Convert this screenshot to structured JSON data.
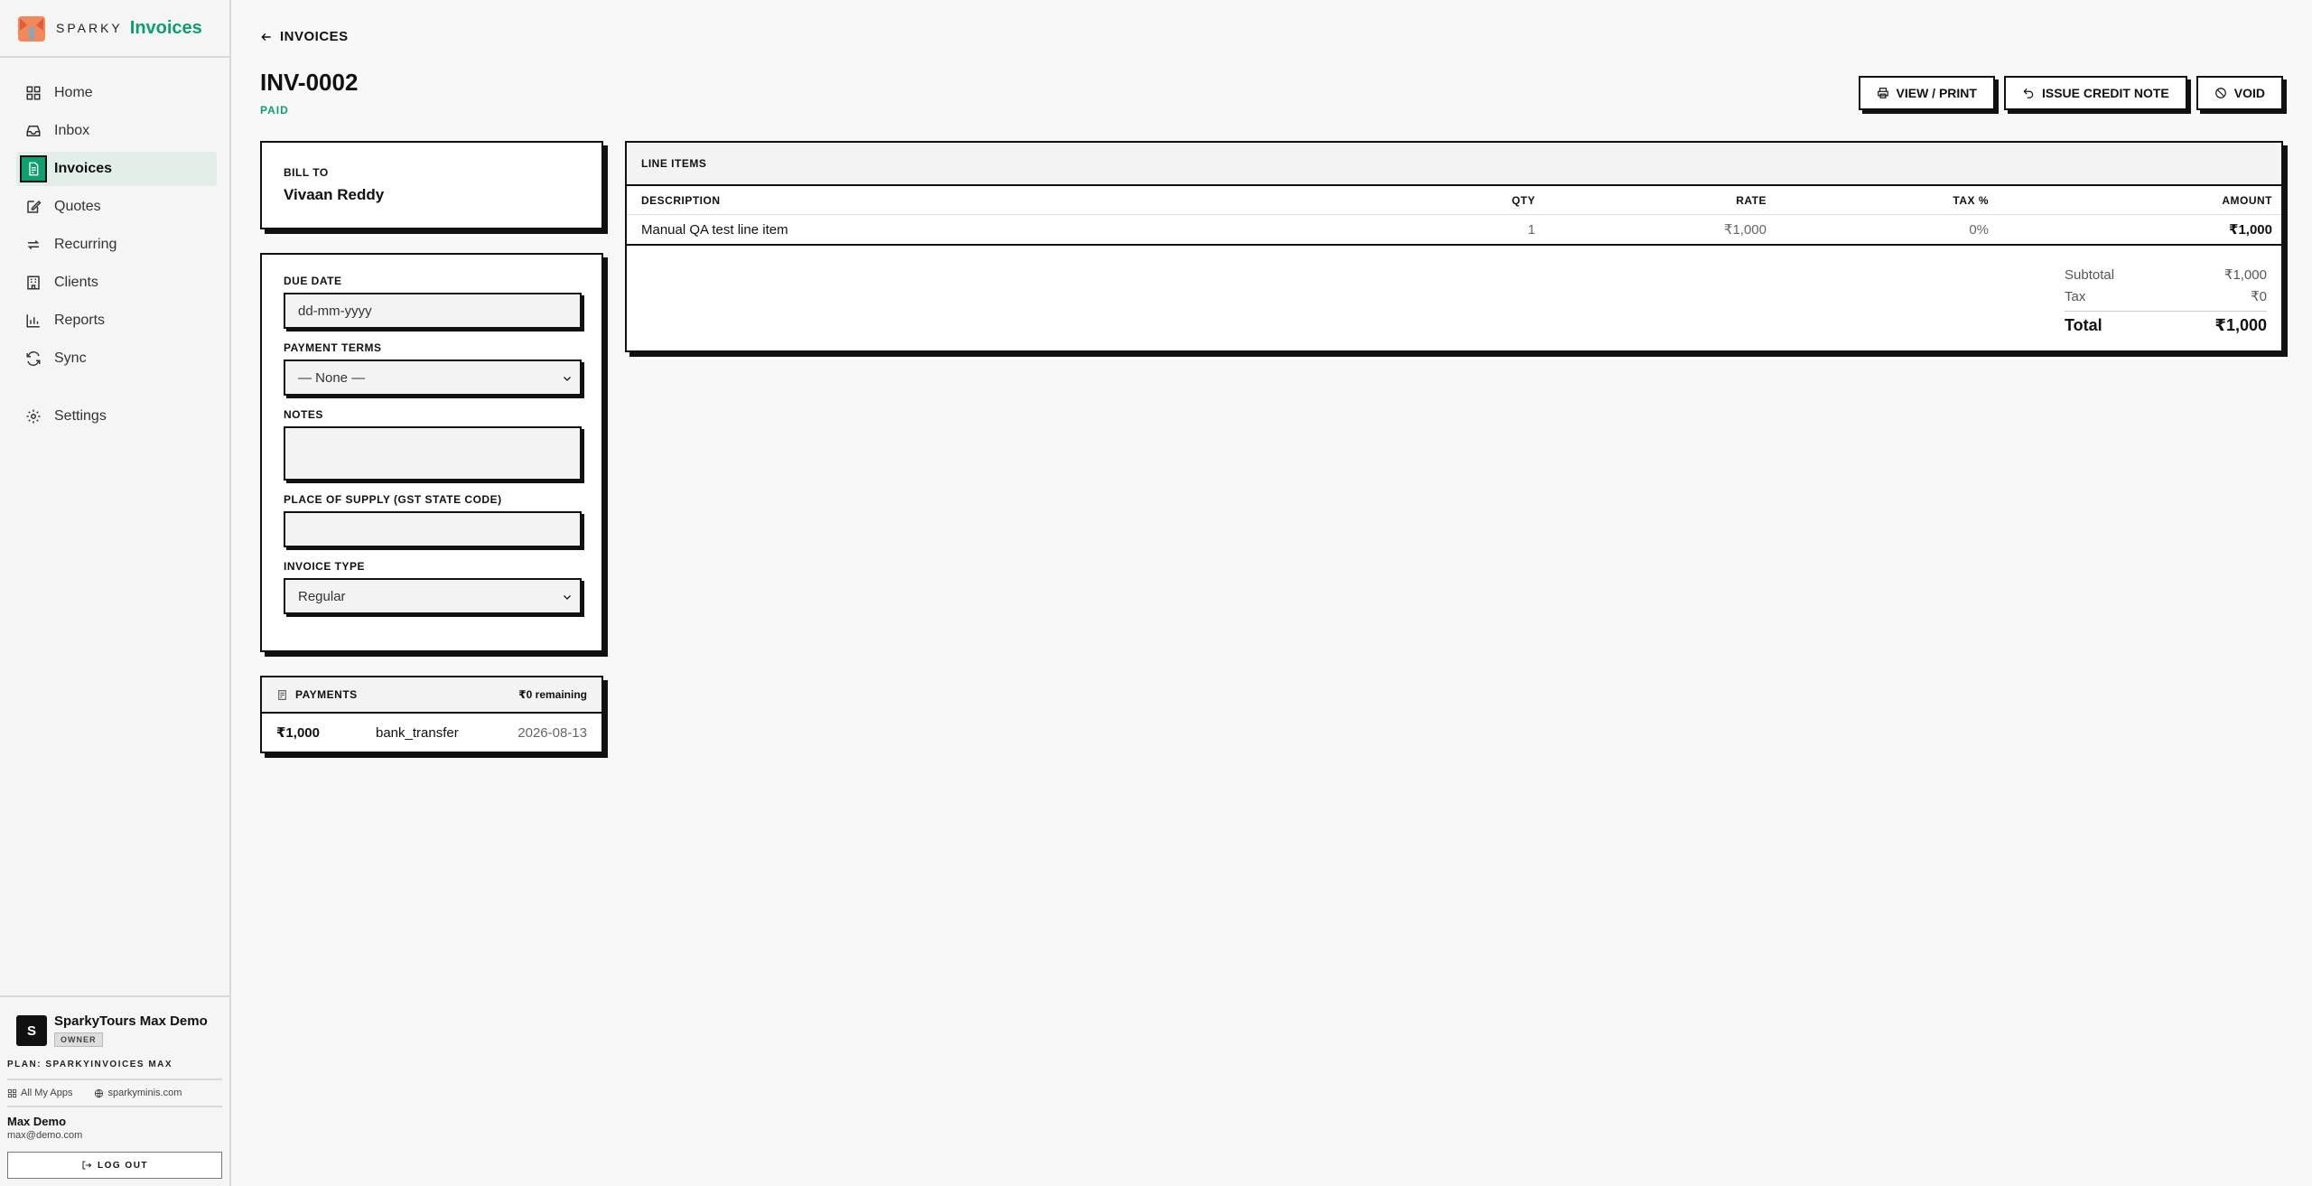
{
  "brand": {
    "sparky": "SPARKY",
    "product": "Invoices"
  },
  "nav": [
    {
      "label": "Home"
    },
    {
      "label": "Inbox"
    },
    {
      "label": "Invoices"
    },
    {
      "label": "Quotes"
    },
    {
      "label": "Recurring"
    },
    {
      "label": "Clients"
    },
    {
      "label": "Reports"
    },
    {
      "label": "Sync"
    },
    {
      "label": "Settings"
    }
  ],
  "org": {
    "initial": "S",
    "name": "SparkyTours Max Demo",
    "role": "OWNER"
  },
  "plan": "PLAN: SPARKYINVOICES MAX",
  "links": {
    "all_apps": "All My Apps",
    "site": "sparkyminis.com"
  },
  "user": {
    "name": "Max Demo",
    "email": "max@demo.com"
  },
  "logout": "LOG OUT",
  "breadcrumb": "INVOICES",
  "invoice": {
    "number": "INV-0002",
    "status": "PAID"
  },
  "actions": {
    "view_print": "VIEW / PRINT",
    "credit_note": "ISSUE CREDIT NOTE",
    "void": "VOID"
  },
  "bill_to": {
    "label": "BILL TO",
    "name": "Vivaan Reddy"
  },
  "form": {
    "due_date_label": "DUE DATE",
    "due_date_value": "dd-mm-yyyy",
    "payment_terms_label": "PAYMENT TERMS",
    "payment_terms_value": "— None —",
    "notes_label": "NOTES",
    "notes_value": "",
    "place_label": "PLACE OF SUPPLY (GST STATE CODE)",
    "place_value": "",
    "invoice_type_label": "INVOICE TYPE",
    "invoice_type_value": "Regular"
  },
  "payments": {
    "title": "PAYMENTS",
    "remaining": "₹0 remaining",
    "rows": [
      {
        "amount": "₹1,000",
        "method": "bank_transfer",
        "date": "2026-08-13"
      }
    ]
  },
  "line_items": {
    "title": "LINE ITEMS",
    "headers": {
      "desc": "DESCRIPTION",
      "qty": "QTY",
      "rate": "RATE",
      "tax": "TAX %",
      "amount": "AMOUNT"
    },
    "rows": [
      {
        "desc": "Manual QA test line item",
        "qty": "1",
        "rate": "₹1,000",
        "tax": "0%",
        "amount": "₹1,000"
      }
    ]
  },
  "totals": {
    "subtotal_label": "Subtotal",
    "subtotal": "₹1,000",
    "tax_label": "Tax",
    "tax": "₹0",
    "total_label": "Total",
    "total": "₹1,000"
  },
  "colors": {
    "accent": "#0d9f6e",
    "ink": "#111111",
    "background": "#f8f8f8"
  }
}
